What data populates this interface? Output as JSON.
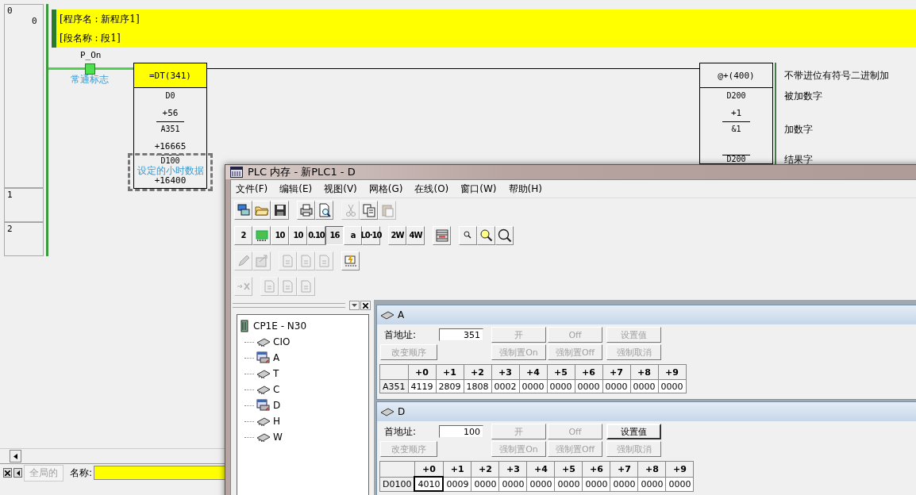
{
  "ladder": {
    "rungs": [
      {
        "number": "0",
        "step": "0"
      },
      {
        "number": "1"
      },
      {
        "number": "2"
      }
    ],
    "header": [
      "[程序名 : 新程序1]",
      "[段名称 : 段1]"
    ],
    "contact": {
      "name": "P_On",
      "comment": "常通标志",
      "on": true
    },
    "compare_block": {
      "instruction": "=DT(341)",
      "operands": [
        {
          "address": "D0",
          "value": "+56",
          "selected": false
        },
        {
          "address": "A351",
          "value": "+16665",
          "selected": false
        },
        {
          "address": "D100",
          "comment": "设定的小时数据",
          "value": "+16400",
          "selected": true
        }
      ]
    },
    "add_block": {
      "instruction": "@+(400)",
      "note": "不带进位有符号二进制加",
      "operands": [
        {
          "address": "D200",
          "value": "+1",
          "note": "被加数字"
        },
        {
          "address": "&1",
          "note": "加数字"
        },
        {
          "address": "D200",
          "note": "结果字"
        }
      ]
    }
  },
  "bottom_bar": {
    "tab": "全局的",
    "tab_disabled": true,
    "name_label": "名称:"
  },
  "memory_window": {
    "title": "PLC 内存 - 新PLC1 - D",
    "menu": [
      "文件(F)",
      "编辑(E)",
      "视图(V)",
      "网格(G)",
      "在线(O)",
      "窗口(W)",
      "帮助(H)"
    ],
    "toolbars": [
      [
        [
          {
            "disabled": false
          },
          {
            "disabled": false
          },
          {
            "disabled": false
          }
        ],
        [
          {
            "disabled": false
          },
          {
            "disabled": false
          }
        ],
        [
          {
            "disabled": true
          },
          {
            "disabled": false
          },
          {
            "disabled": true
          }
        ]
      ],
      [
        [
          {
            "label": "2",
            "selected": false,
            "disabled": false
          },
          {
            "selected": false,
            "disabled": false
          },
          {
            "label": "10",
            "selected": false,
            "disabled": false
          },
          {
            "label": "10",
            "selected": false,
            "disabled": false
          },
          {
            "label": "0.10",
            "selected": false,
            "disabled": false
          },
          {
            "label": "16",
            "selected": true,
            "disabled": false
          },
          {
            "label": "a",
            "selected": false,
            "disabled": false
          },
          {
            "label": "L0·10",
            "selected": false,
            "disabled": false
          }
        ],
        [
          {
            "label": "2W",
            "disabled": false
          },
          {
            "label": "4W",
            "disabled": false
          }
        ],
        [
          {
            "disabled": false
          }
        ],
        [
          {
            "disabled": false
          },
          {
            "disabled": false
          },
          {
            "disabled": false
          }
        ]
      ],
      [
        [
          {
            "disabled": true
          },
          {
            "disabled": true
          }
        ],
        [
          {
            "disabled": true
          },
          {
            "disabled": true
          },
          {
            "disabled": true
          }
        ],
        [
          {
            "disabled": false
          }
        ]
      ],
      [
        [
          {
            "disabled": true
          }
        ],
        [
          {
            "disabled": true
          },
          {
            "disabled": true
          },
          {
            "disabled": true
          }
        ]
      ]
    ],
    "tree": {
      "root": "CP1E - N30",
      "children": [
        {
          "label": "CIO",
          "open": false
        },
        {
          "label": "A",
          "open": true
        },
        {
          "label": "T",
          "open": false
        },
        {
          "label": "C",
          "open": false
        },
        {
          "label": "D",
          "open": true
        },
        {
          "label": "H",
          "open": false
        },
        {
          "label": "W",
          "open": false
        }
      ]
    },
    "memory_panels": [
      {
        "area": "A",
        "address_label": "首地址:",
        "start_address": "351",
        "buttons": [
          {
            "label": "开",
            "disabled": true
          },
          {
            "label": "Off",
            "disabled": true
          },
          {
            "label": "设置值",
            "disabled": true
          },
          {
            "label": "改变顺序",
            "disabled": true
          },
          {
            "label": "强制置On",
            "disabled": true
          },
          {
            "label": "强制置Off",
            "disabled": true
          },
          {
            "label": "强制取消",
            "disabled": true
          }
        ],
        "columns": [
          "+0",
          "+1",
          "+2",
          "+3",
          "+4",
          "+5",
          "+6",
          "+7",
          "+8",
          "+9"
        ],
        "rows": [
          {
            "address": "A351",
            "cells": [
              {
                "value": "4119",
                "selected": false
              },
              {
                "value": "2809",
                "selected": false
              },
              {
                "value": "1808",
                "selected": false
              },
              {
                "value": "0002",
                "selected": false
              },
              {
                "value": "0000",
                "selected": false
              },
              {
                "value": "0000",
                "selected": false
              },
              {
                "value": "0000",
                "selected": false
              },
              {
                "value": "0000",
                "selected": false
              },
              {
                "value": "0000",
                "selected": false
              },
              {
                "value": "0000",
                "selected": false
              }
            ]
          }
        ]
      },
      {
        "area": "D",
        "address_label": "首地址:",
        "start_address": "100",
        "buttons": [
          {
            "label": "开",
            "disabled": true
          },
          {
            "label": "Off",
            "disabled": true
          },
          {
            "label": "设置值",
            "disabled": false
          },
          {
            "label": "改变顺序",
            "disabled": true
          },
          {
            "label": "强制置On",
            "disabled": true
          },
          {
            "label": "强制置Off",
            "disabled": true
          },
          {
            "label": "强制取消",
            "disabled": true
          }
        ],
        "columns": [
          "+0",
          "+1",
          "+2",
          "+3",
          "+4",
          "+5",
          "+6",
          "+7",
          "+8",
          "+9"
        ],
        "rows": [
          {
            "address": "D0100",
            "cells": [
              {
                "value": "4010",
                "selected": true
              },
              {
                "value": "0009",
                "selected": false
              },
              {
                "value": "0000",
                "selected": false
              },
              {
                "value": "0000",
                "selected": false
              },
              {
                "value": "0000",
                "selected": false
              },
              {
                "value": "0000",
                "selected": false
              },
              {
                "value": "0000",
                "selected": false
              },
              {
                "value": "0000",
                "selected": false
              },
              {
                "value": "0000",
                "selected": false
              },
              {
                "value": "0000",
                "selected": false
              }
            ]
          }
        ]
      }
    ]
  }
}
